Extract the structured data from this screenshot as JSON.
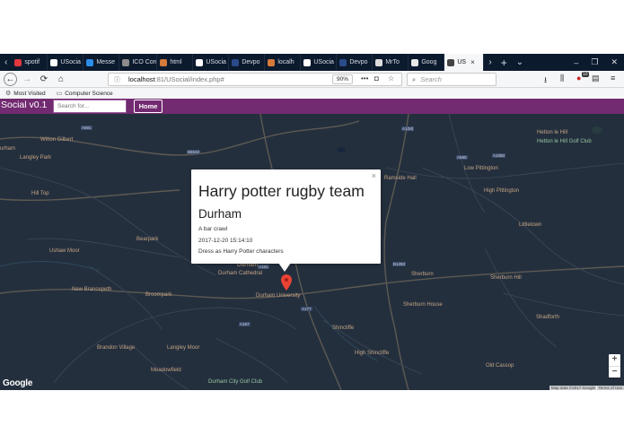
{
  "browser": {
    "tabs": [
      {
        "label": "spotif",
        "favicon_color": "#e0383e"
      },
      {
        "label": "USocia",
        "favicon_color": "#ffffff"
      },
      {
        "label": "Messe",
        "favicon_color": "#2b8de8"
      },
      {
        "label": "ICO Conv",
        "favicon_color": "#8b8b8b"
      },
      {
        "label": "html",
        "favicon_color": "#d57a3b"
      },
      {
        "label": "USocia",
        "favicon_color": "#ffffff"
      },
      {
        "label": "Devpo",
        "favicon_color": "#2a4a8a"
      },
      {
        "label": "localh",
        "favicon_color": "#d57a3b"
      },
      {
        "label": "USocia",
        "favicon_color": "#ffffff"
      },
      {
        "label": "Devpo",
        "favicon_color": "#2a4a8a"
      },
      {
        "label": "MrTo",
        "favicon_color": "#dddddd"
      },
      {
        "label": "Goog",
        "favicon_color": "#e8e8e8"
      },
      {
        "label": "US",
        "favicon_color": "#444444",
        "active": true
      }
    ],
    "url": {
      "host": "localhost",
      "path": ":81/USocial/index.php#"
    },
    "zoom": "90%",
    "search_placeholder": "Search",
    "library_badge": "10",
    "bookmarks": [
      {
        "label": "Most Visited",
        "icon": "gear-icon"
      },
      {
        "label": "Computer Science",
        "icon": "folder-icon"
      }
    ]
  },
  "site": {
    "brand": "Social v0.1",
    "search_placeholder": "Search for...",
    "home_label": "Home",
    "header_color": "#722a71"
  },
  "map": {
    "places": [
      "Witton Gilbert",
      "Langley Park",
      "Hill Top",
      "Bearpark",
      "Ushaw Moor",
      "New Brancepeth",
      "Broompark",
      "Brandon Village",
      "Langley Moor",
      "Meadowfield",
      "Durham",
      "Durham Cathedral",
      "Durham University",
      "Shincliffe",
      "High Shincliffe",
      "Sherburn House",
      "Sherburn Hill",
      "Shadforth",
      "Littletown",
      "High Pittington",
      "Low Pittington",
      "Hetton le Hill Golf Club",
      "Hetton le Hill",
      "Ramside Hall",
      "Durham City Golf Club",
      "Old Cassop",
      "Sherburn",
      "urham"
    ],
    "road_labels": [
      "A691",
      "A167",
      "A690",
      "A181",
      "A1(M)",
      "B6532",
      "B1283",
      "A177",
      "A1050"
    ],
    "attribution": "Map data ©2017 Google",
    "terms": "Terms of Use",
    "logo": "Google",
    "zoom_in": "+",
    "zoom_out": "−"
  },
  "infowindow": {
    "title": "Harry potter rugby team",
    "location": "Durham",
    "description": "A bar crawl",
    "datetime": "2017-12-20 15:14:10",
    "note": "Dress as Harry Potter characters",
    "close": "×"
  }
}
